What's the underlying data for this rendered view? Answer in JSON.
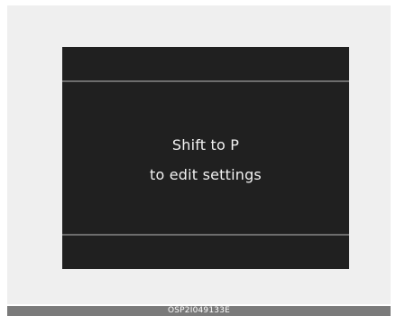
{
  "display": {
    "message_line1": "Shift to P",
    "message_line2": "to edit settings"
  },
  "caption": {
    "code": "OSP2I049133E"
  },
  "colors": {
    "screen_background": "#202020",
    "divider": "#6d6d6d",
    "text": "#f2f2f2",
    "frame_background": "#efefef",
    "caption_bar": "#7a7a7a"
  }
}
